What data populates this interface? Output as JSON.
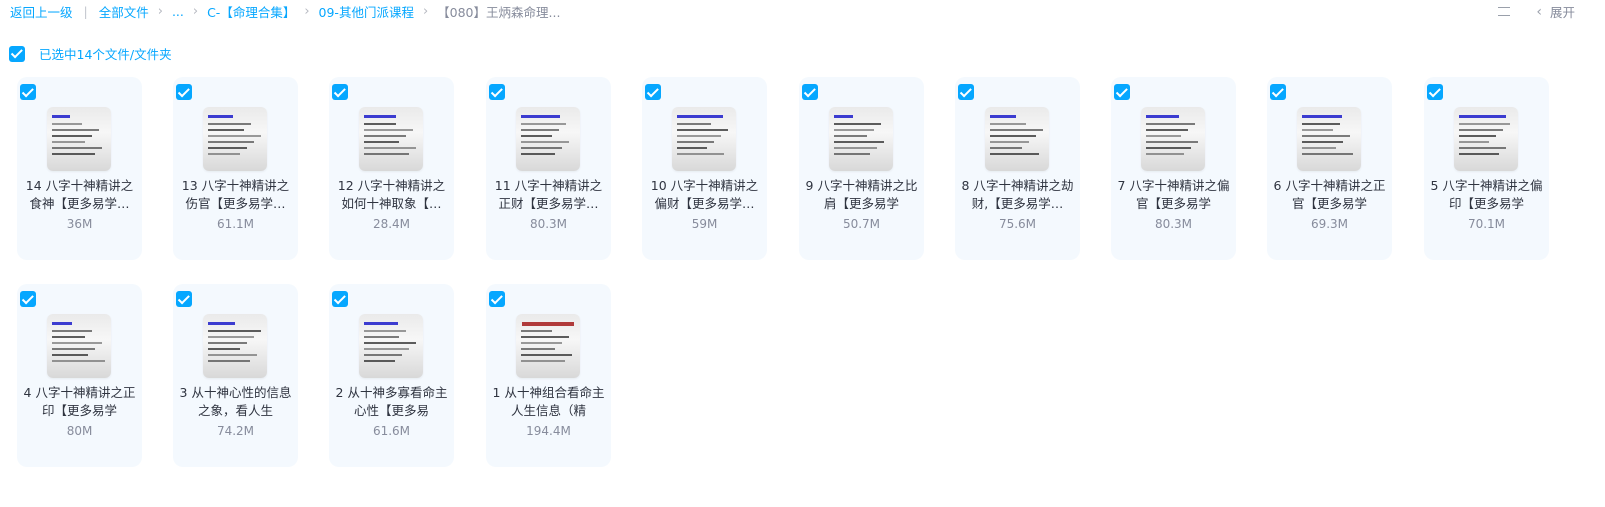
{
  "breadcrumb": {
    "back": "返回上一级",
    "all_files": "全部文件",
    "ellipsis": "...",
    "folder1": "C-【命理合集】",
    "folder2": "09-其他门派课程",
    "current": "【080】王炳森命理..."
  },
  "toolbar": {
    "expand": "展开"
  },
  "selection": {
    "text": "已选中14个文件/文件夹"
  },
  "files": [
    {
      "name": "14 八字十神精讲之食神【更多易学…",
      "size": "36M"
    },
    {
      "name": "13 八字十神精讲之伤官【更多易学…",
      "size": "61.1M"
    },
    {
      "name": "12 八字十神精讲之如何十神取象【…",
      "size": "28.4M"
    },
    {
      "name": "11 八字十神精讲之正财【更多易学…",
      "size": "80.3M"
    },
    {
      "name": "10 八字十神精讲之偏财【更多易学…",
      "size": "59M"
    },
    {
      "name": "9 八字十神精讲之比肩【更多易学",
      "size": "50.7M"
    },
    {
      "name": "8 八字十神精讲之劫财,【更多易学…",
      "size": "75.6M"
    },
    {
      "name": "7 八字十神精讲之偏官【更多易学",
      "size": "80.3M"
    },
    {
      "name": "6 八字十神精讲之正官【更多易学",
      "size": "69.3M"
    },
    {
      "name": "5 八字十神精讲之偏印【更多易学",
      "size": "70.1M"
    },
    {
      "name": "4 八字十神精讲之正印【更多易学",
      "size": "80M"
    },
    {
      "name": "3 从十神心性的信息之象，看人生",
      "size": "74.2M"
    },
    {
      "name": "2 从十神多寡看命主心性【更多易",
      "size": "61.6M"
    },
    {
      "name": "1 从十神组合看命主人生信息（精",
      "size": "194.4M"
    }
  ],
  "colors": {
    "accent": "#06a7ff",
    "card_bg": "#f4f9fe"
  }
}
